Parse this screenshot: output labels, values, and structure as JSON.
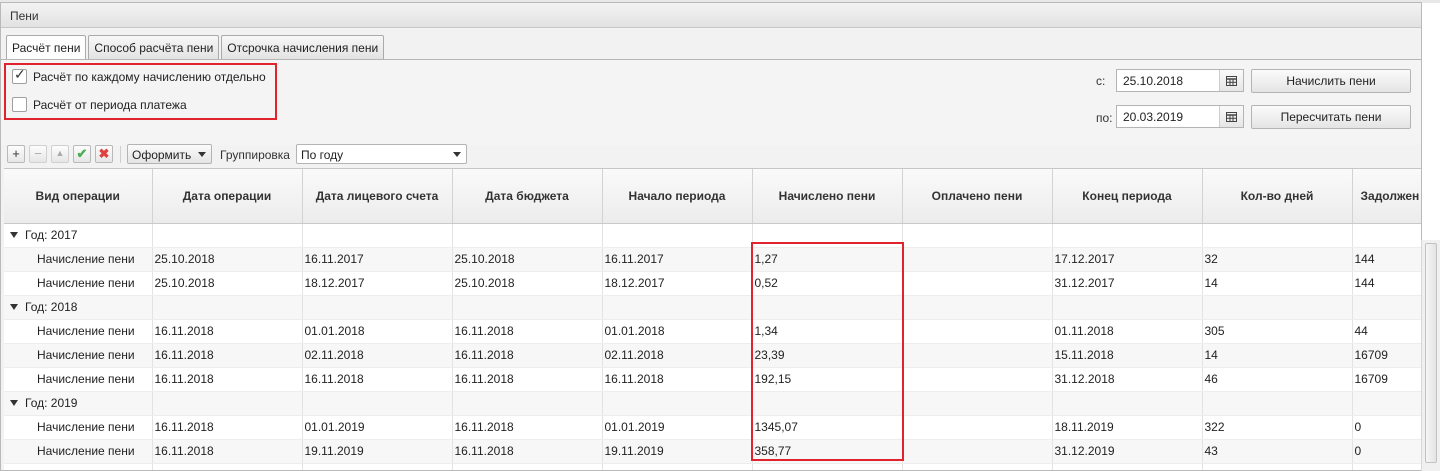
{
  "window": {
    "title": "Пени"
  },
  "tabs": [
    {
      "label": "Расчёт пени",
      "active": true
    },
    {
      "label": "Способ расчёта пени",
      "active": false
    },
    {
      "label": "Отсрочка начисления пени",
      "active": false
    }
  ],
  "options": [
    {
      "label": "Расчёт по каждому начислению отдельно",
      "checked": true
    },
    {
      "label": "Расчёт от периода платежа",
      "checked": false
    }
  ],
  "period": {
    "from_label": "с:",
    "from_value": "25.10.2018",
    "to_label": "по:",
    "to_value": "20.03.2019",
    "calc_button": "Начислить пени",
    "recalc_button": "Пересчитать пени"
  },
  "toolbar": {
    "add_icon": "plus-icon",
    "remove_icon": "minus-icon",
    "up_icon": "arrow-up-icon",
    "accept_icon": "check-icon",
    "delete_icon": "red-x-icon",
    "format_label": "Оформить",
    "grouping_label": "Группировка",
    "grouping_value": "По году"
  },
  "table": {
    "columns": [
      "Вид операции",
      "Дата операции",
      "Дата лицевого счета",
      "Дата бюджета",
      "Начало периода",
      "Начислено пени",
      "Оплачено пени",
      "Конец периода",
      "Кол-во дней",
      "Задолжен"
    ],
    "groups": [
      {
        "label": "Год: 2017",
        "rows": [
          [
            "Начисление пени",
            "25.10.2018",
            "16.11.2017",
            "25.10.2018",
            "16.11.2017",
            "1,27",
            "",
            "17.12.2017",
            "32",
            "144"
          ],
          [
            "Начисление пени",
            "25.10.2018",
            "18.12.2017",
            "25.10.2018",
            "18.12.2017",
            "0,52",
            "",
            "31.12.2017",
            "14",
            "144"
          ]
        ]
      },
      {
        "label": "Год: 2018",
        "rows": [
          [
            "Начисление пени",
            "16.11.2018",
            "01.01.2018",
            "16.11.2018",
            "01.01.2018",
            "1,34",
            "",
            "01.11.2018",
            "305",
            "44"
          ],
          [
            "Начисление пени",
            "16.11.2018",
            "02.11.2018",
            "16.11.2018",
            "02.11.2018",
            "23,39",
            "",
            "15.11.2018",
            "14",
            "16709"
          ],
          [
            "Начисление пени",
            "16.11.2018",
            "16.11.2018",
            "16.11.2018",
            "16.11.2018",
            "192,15",
            "",
            "31.12.2018",
            "46",
            "16709"
          ]
        ]
      },
      {
        "label": "Год: 2019",
        "rows": [
          [
            "Начисление пени",
            "16.11.2018",
            "01.01.2019",
            "16.11.2018",
            "01.01.2019",
            "1345,07",
            "",
            "18.11.2019",
            "322",
            "0"
          ],
          [
            "Начисление пени",
            "16.11.2018",
            "19.11.2019",
            "16.11.2018",
            "19.11.2019",
            "358,77",
            "",
            "31.12.2019",
            "43",
            "0"
          ]
        ]
      }
    ]
  },
  "colors": {
    "highlight": "#e0232d"
  }
}
